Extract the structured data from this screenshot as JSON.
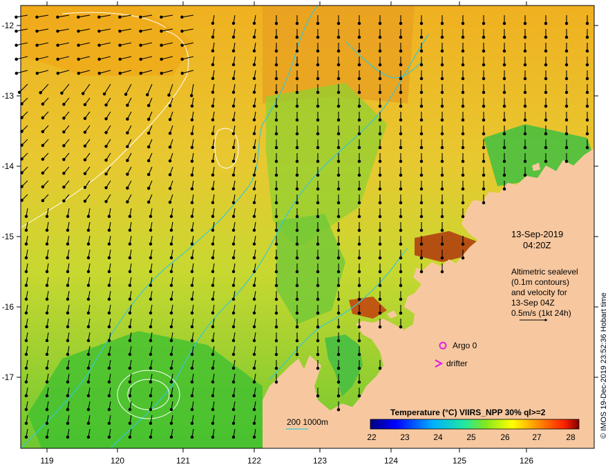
{
  "map": {
    "lon_ticks": [
      "119",
      "120",
      "121",
      "122",
      "123",
      "124",
      "125",
      "126"
    ],
    "lat_ticks": [
      "-12",
      "-13",
      "-14",
      "-15",
      "-16",
      "-17"
    ],
    "timestamp_date": "13-Sep-2019",
    "timestamp_time": "04:20Z",
    "altimetry_lines": [
      "Altimetric sealevel",
      "(0.1m contours)",
      "and velocity for",
      "13-Sep 04Z",
      "0.5m/s (1kt 24h)"
    ],
    "argo_label": "Argo 0",
    "drifter_label": "drifter",
    "bathymetry_label": "200  1000m",
    "credit": "© IMOS 19-Dec-2019 23:52:36 Hobart time",
    "colorbar": {
      "title": "Temperature (°C) VIIRS_NPP 30% ql>=2",
      "labels": [
        "22",
        "23",
        "24",
        "25",
        "26",
        "27",
        "28"
      ]
    },
    "colors": {
      "land": "#f7c8a0",
      "bathymetry_contour": "#34c8d8",
      "marker": "#e020e0"
    }
  }
}
